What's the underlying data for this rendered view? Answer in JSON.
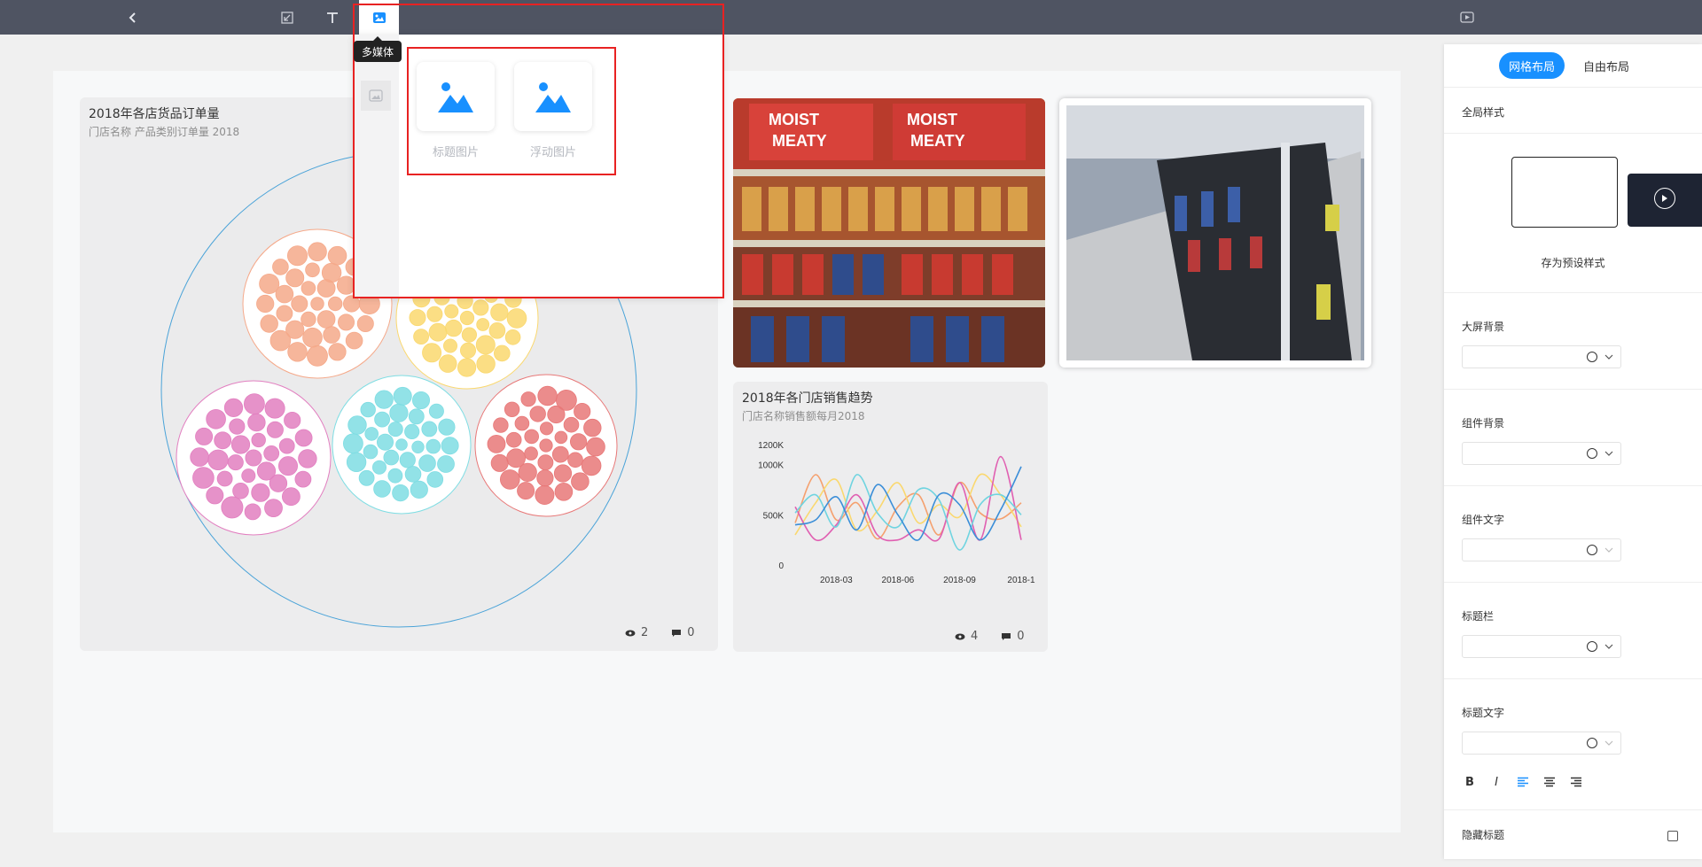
{
  "toolbar": {
    "icons": [
      "back-chevron-icon",
      "import-icon",
      "text-icon",
      "image-icon",
      "preview-icon"
    ],
    "tooltip": "多媒体"
  },
  "popup": {
    "cards": [
      {
        "label": "标题图片",
        "icon": "image-icon"
      },
      {
        "label": "浮动图片",
        "icon": "image-icon"
      }
    ],
    "highlight_color": "#e82222"
  },
  "bubble_panel": {
    "title": "2018年各店货品订单量",
    "subtitle": "门店名称 产品类别订单量 2018",
    "views": "2",
    "comments": "0",
    "group_colors": [
      "#f5a98a",
      "#fad86f",
      "#e27fc0",
      "#7fdde3",
      "#e87878"
    ]
  },
  "line_panel": {
    "title": "2018年各门店销售趋势",
    "subtitle": "门店名称销售额每月2018",
    "views": "4",
    "comments": "0"
  },
  "chart_data": {
    "type": "line",
    "title": "2018年各门店销售趋势",
    "subtitle": "门店名称销售额每月2018",
    "x_tick_labels": [
      "2018-03",
      "2018-06",
      "2018-09",
      "2018-1"
    ],
    "y_tick_labels": [
      "0",
      "500K",
      "1000K",
      "1200K"
    ],
    "ylim": [
      0,
      1200000
    ],
    "x": [
      "2018-01",
      "2018-02",
      "2018-03",
      "2018-04",
      "2018-05",
      "2018-06",
      "2018-07",
      "2018-08",
      "2018-09",
      "2018-10",
      "2018-11",
      "2018-12"
    ],
    "series": [
      {
        "color": "#f5a06e",
        "values": [
          420000,
          900000,
          450000,
          620000,
          260000,
          580000,
          700000,
          300000,
          820000,
          520000,
          460000,
          620000
        ]
      },
      {
        "color": "#fad86f",
        "values": [
          300000,
          620000,
          850000,
          350000,
          540000,
          820000,
          420000,
          600000,
          480000,
          900000,
          700000,
          380000
        ]
      },
      {
        "color": "#e05fb1",
        "values": [
          580000,
          250000,
          400000,
          700000,
          300000,
          250000,
          350000,
          260000,
          820000,
          250000,
          1080000,
          250000
        ]
      },
      {
        "color": "#6fd4e0",
        "values": [
          520000,
          700000,
          380000,
          900000,
          520000,
          380000,
          750000,
          650000,
          150000,
          600000,
          700000,
          500000
        ]
      },
      {
        "color": "#3b8ed8",
        "values": [
          400000,
          450000,
          680000,
          350000,
          800000,
          500000,
          250000,
          700000,
          600000,
          250000,
          550000,
          980000
        ]
      }
    ]
  },
  "sidebar": {
    "layout_tabs": [
      "网格布局",
      "自由布局"
    ],
    "global_style": "全局样式",
    "preset_save": "存为预设样式",
    "fields": [
      "大屏背景",
      "组件背景",
      "组件文字",
      "标题栏",
      "标题文字"
    ],
    "format_buttons": [
      "B",
      "I"
    ],
    "hide_title": "隐藏标题",
    "accent_color": "#1890ff"
  }
}
